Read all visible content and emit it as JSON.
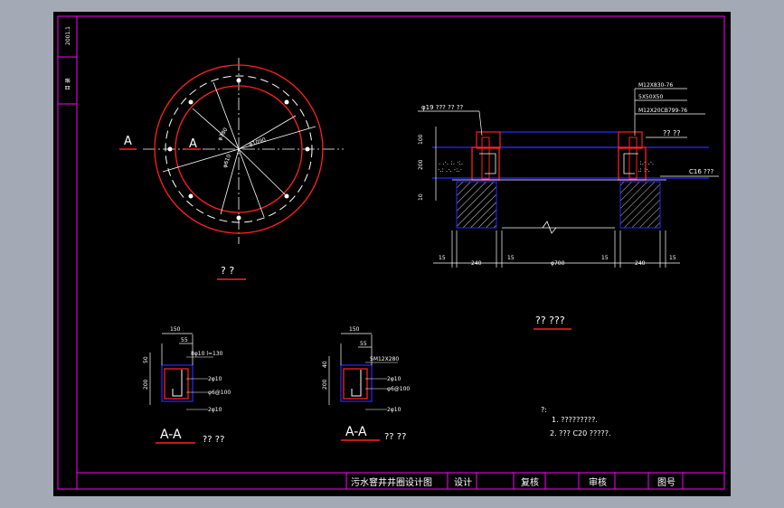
{
  "colors": {
    "background_app": "#a3a9b5",
    "drawing_bg": "#000000",
    "frame": "#ff00ff",
    "outline_blue": "#2a2aff",
    "red": "#ff2020",
    "white": "#ffffff",
    "hatch": "#d0d0d0"
  },
  "plan_view": {
    "section_label_left": "A",
    "section_label_right": "A",
    "dim_outer": "φ1090",
    "dim_mid": "φ780",
    "dim_inner": "φ610",
    "caption": "? ?"
  },
  "elevation": {
    "callout_left": "φ19 ??? ?? ??",
    "callout_1": "M12X830-76",
    "callout_2": "5X50X50",
    "callout_3": "M12X20CB799-76",
    "callout_4": "?? ??",
    "callout_5": "C16 ???",
    "dim_v_100": "100",
    "dim_v_200": "200",
    "dim_v_10": "10",
    "dims_bottom": [
      "15",
      "240",
      "15",
      "φ700",
      "15",
      "240",
      "15"
    ],
    "caption": "?? ???"
  },
  "section_left": {
    "dim_150": "150",
    "dim_55": "55",
    "dim_50": "50",
    "dim_200": "200",
    "label_top": "8φ10 l=130",
    "label_2": "2φ10",
    "label_3": "φ6@100",
    "label_4": "2φ10",
    "title": "A-A",
    "caption": "?? ??"
  },
  "section_right": {
    "dim_150": "150",
    "dim_55": "55",
    "dim_40": "40",
    "dim_200": "200",
    "label_top": "5M12X280",
    "label_2": "2φ10",
    "label_3": "φ6@100",
    "label_4": "2φ10",
    "title": "A-A",
    "caption": "?? ??"
  },
  "notes": {
    "heading": "?:",
    "line1": "1. ?????????.",
    "line2": "2. ??? C20  ?????."
  },
  "title_block": {
    "drawing_title": "污水窨井井圈设计图",
    "design_label": "设计",
    "review_label": "复核",
    "approve_label": "审核",
    "drawing_no_label": "图号"
  },
  "side_strip": {
    "top_text": "2001.1",
    "bottom_text": "目 录"
  }
}
